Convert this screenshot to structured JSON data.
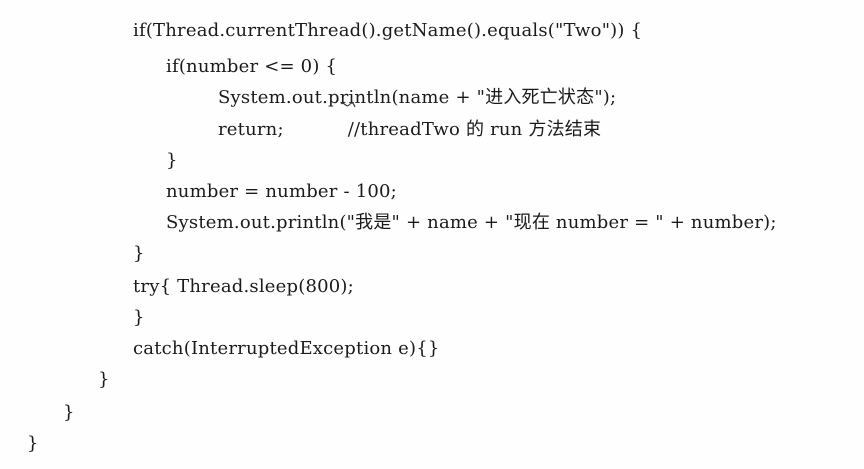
{
  "code": {
    "lines": [
      "if(Thread.currentThread().getName().equals(\"Two\")) {",
      "if(number <= 0) {",
      "System.out.println(name + \"进入死亡状态\");",
      "return;",
      "//threadTwo 的 run 方法结束",
      "}",
      "number = number - 100;",
      "System.out.println(\"我是\" + name + \"现在 number = \" + number);",
      "}",
      "try{ Thread.sleep(800);",
      "}",
      "catch(InterruptedException e){}",
      "}",
      "}",
      "}"
    ]
  }
}
